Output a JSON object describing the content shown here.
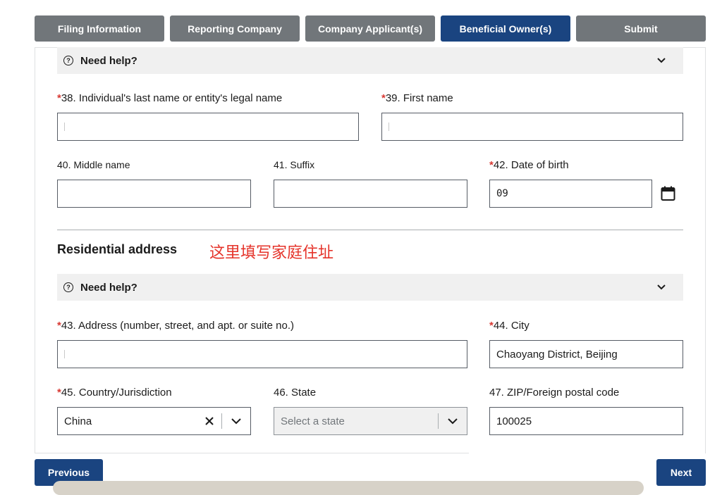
{
  "tabs": [
    {
      "label": "Filing Information",
      "active": false
    },
    {
      "label": "Reporting Company",
      "active": false
    },
    {
      "label": "Company Applicant(s)",
      "active": false
    },
    {
      "label": "Beneficial Owner(s)",
      "active": true
    },
    {
      "label": "Submit",
      "active": false
    }
  ],
  "help": {
    "label": "Need help?",
    "icon": "question-circle-icon"
  },
  "fields": {
    "last_name": {
      "num": "38. Individual's last name or entity's legal name",
      "required": "*",
      "value": ""
    },
    "first_name": {
      "num": "39. First name",
      "required": "*",
      "value": ""
    },
    "middle_name": {
      "num": "40. Middle name",
      "value": ""
    },
    "suffix": {
      "num": "41. Suffix",
      "value": ""
    },
    "dob": {
      "num": "42. Date of birth",
      "required": "*",
      "value": "09"
    },
    "address": {
      "num": "43. Address (number, street, and apt. or suite no.)",
      "required": "*",
      "value": ""
    },
    "city": {
      "num": "44. City",
      "required": "*",
      "value": "Chaoyang District, Beijing"
    },
    "country": {
      "num": "45. Country/Jurisdiction",
      "required": "*",
      "value": "China"
    },
    "state": {
      "num": "46. State",
      "placeholder": "Select a state"
    },
    "zip": {
      "num": "47. ZIP/Foreign postal code",
      "value": "100025"
    }
  },
  "section": {
    "title": "Residential address",
    "annotation": "这里填写家庭住址"
  },
  "buttons": {
    "previous": "Previous",
    "next": "Next"
  },
  "colors": {
    "active_tab": "#1a4480",
    "inactive_tab": "#71767a",
    "required": "#d83933",
    "annotation": "#e5332a"
  }
}
